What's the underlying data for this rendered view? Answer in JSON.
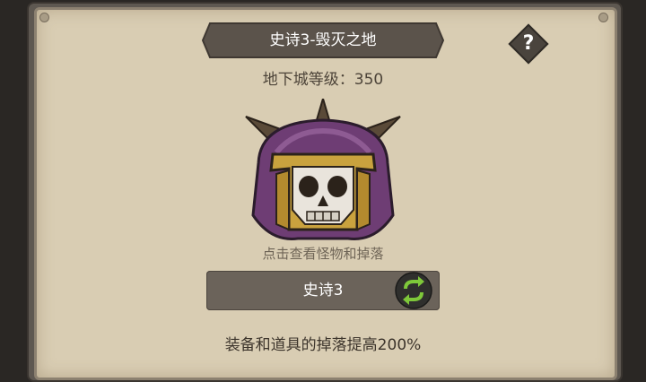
{
  "dungeon": {
    "title": "史诗3-毁灭之地",
    "level_label": "地下城等级：",
    "level_value": "350"
  },
  "help": {
    "glyph": "?"
  },
  "boss": {
    "icon": "skull-helmet-icon",
    "hint": "点击查看怪物和掉落"
  },
  "mode": {
    "label": "史诗3",
    "swap_icon": "swap-arrows-icon"
  },
  "bonus": {
    "text": "装备和道具的掉落提高200%"
  },
  "colors": {
    "parchment": "#d9cdb3",
    "banner": "#5b534b",
    "swap_button": "#2f2f2d",
    "swap_arrows": "#7ec83a",
    "helmet_purple": "#6e3d74",
    "helmet_gold": "#c9a23e"
  }
}
